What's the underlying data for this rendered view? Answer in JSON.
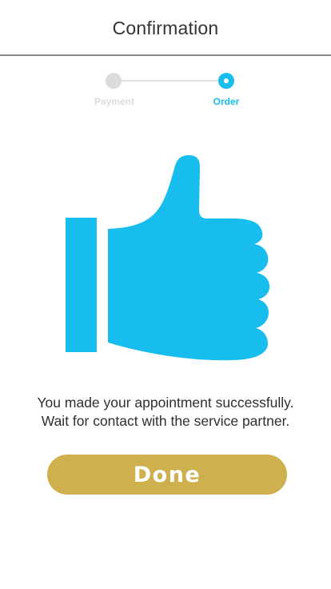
{
  "header": {
    "title": "Confirmation"
  },
  "stepper": {
    "steps": [
      {
        "label": "Payment",
        "state": "completed"
      },
      {
        "label": "Order",
        "state": "active"
      }
    ]
  },
  "illustration": {
    "icon": "thumbs-up-icon",
    "color": "#17bdec"
  },
  "message": {
    "line1": "You made your appointment successfully.",
    "line2": "Wait for contact with the service partner."
  },
  "actions": {
    "done_label": "Done"
  },
  "colors": {
    "accent": "#17bdec",
    "button": "#cfb04f",
    "inactive": "#dcdcdc"
  }
}
